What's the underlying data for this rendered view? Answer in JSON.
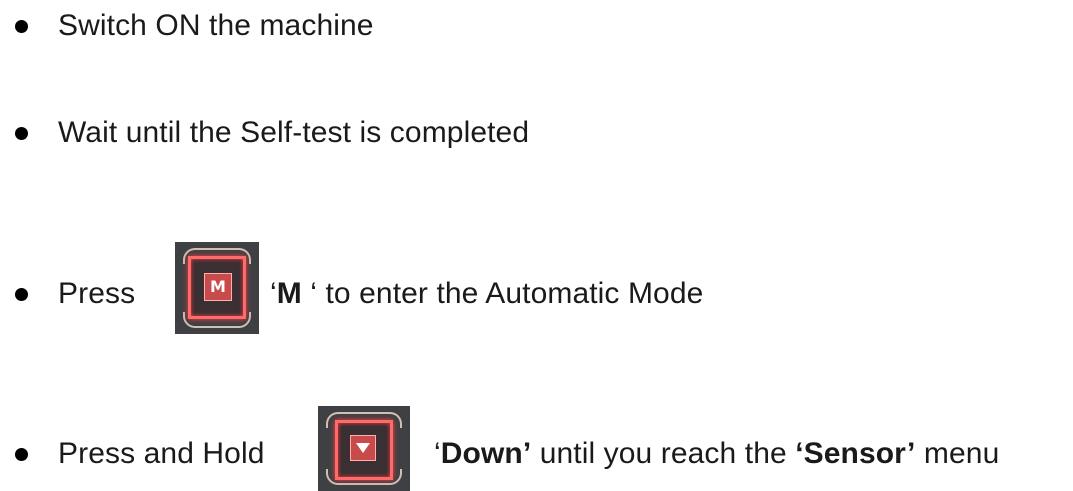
{
  "steps": [
    {
      "segments": [
        {
          "text": "Switch ON the machine",
          "bold": false
        }
      ]
    },
    {
      "segments": [
        {
          "text": "Wait until the Self-test is completed",
          "bold": false
        }
      ]
    },
    {
      "prefix": "Press",
      "key_label": "M",
      "key_icon": "m-key-icon",
      "segments": [
        {
          "text": "‘",
          "bold": false
        },
        {
          "text": "M",
          "bold": true
        },
        {
          "text": " ‘ to enter the Automatic Mode",
          "bold": false
        }
      ]
    },
    {
      "prefix": "Press  and  Hold",
      "key_icon": "down-arrow-key-icon",
      "segments": [
        {
          "text": "‘",
          "bold": false
        },
        {
          "text": "Down’",
          "bold": true
        },
        {
          "text": " until you reach the ",
          "bold": false
        },
        {
          "text": "‘Sensor’",
          "bold": true
        },
        {
          "text": " menu",
          "bold": false
        }
      ]
    }
  ],
  "colors": {
    "key_background": "#3f4044",
    "key_glow": "#ff6b6b",
    "key_face": "#c94a4a"
  }
}
